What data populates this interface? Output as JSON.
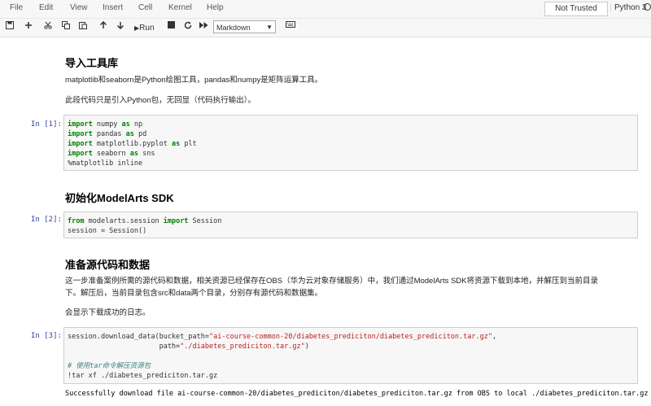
{
  "menu": [
    "File",
    "Edit",
    "View",
    "Insert",
    "Cell",
    "Kernel",
    "Help"
  ],
  "trusted_label": "Not Trusted",
  "kernel_name": "Python 3",
  "toolbar": {
    "run_label": "Run",
    "cell_type": "Markdown"
  },
  "sections": {
    "s1": {
      "heading": "导入工具库",
      "p1": "matplotlib和seaborn是Python绘图工具，pandas和numpy是矩阵运算工具。",
      "p2": "此段代码只是引入Python包，无回显（代码执行输出）。"
    },
    "cell1": {
      "prompt": "In [1]:",
      "lines": [
        [
          {
            "t": "import",
            "c": "kw"
          },
          {
            "t": " numpy "
          },
          {
            "t": "as",
            "c": "kw"
          },
          {
            "t": " np"
          }
        ],
        [
          {
            "t": "import",
            "c": "kw"
          },
          {
            "t": " pandas "
          },
          {
            "t": "as",
            "c": "kw"
          },
          {
            "t": " pd"
          }
        ],
        [
          {
            "t": "import",
            "c": "kw"
          },
          {
            "t": " matplotlib.pyplot "
          },
          {
            "t": "as",
            "c": "kw"
          },
          {
            "t": " plt"
          }
        ],
        [
          {
            "t": "import",
            "c": "kw"
          },
          {
            "t": " seaborn "
          },
          {
            "t": "as",
            "c": "kw"
          },
          {
            "t": " sns"
          }
        ],
        [
          {
            "t": "%matplotlib inline"
          }
        ]
      ]
    },
    "s2": {
      "heading": "初始化ModelArts SDK"
    },
    "cell2": {
      "prompt": "In [2]:",
      "lines": [
        [
          {
            "t": "from",
            "c": "kw"
          },
          {
            "t": " modelarts.session "
          },
          {
            "t": "import",
            "c": "kw"
          },
          {
            "t": " Session"
          }
        ],
        [
          {
            "t": "session = Session()"
          }
        ]
      ]
    },
    "s3": {
      "heading": "准备源代码和数据",
      "p1_line1": "这一步准备案例所需的源代码和数据，相关资源已经保存在OBS（华为云对象存储服务）中，我们通过ModelArts SDK将资源下载到本地，并解压到当前目录",
      "p1_line2": "下。解压后，当前目录包含src和data两个目录，分别存有源代码和数据集。",
      "p2": "会显示下载成功的日志。"
    },
    "cell3": {
      "prompt": "In [3]:",
      "lines": [
        [
          {
            "t": "session.download_data(bucket_path="
          },
          {
            "t": "\"ai-course-common-20/diabetes_prediciton/diabetes_prediciton.tar.gz\"",
            "c": "str"
          },
          {
            "t": ","
          }
        ],
        [
          {
            "t": "                      path="
          },
          {
            "t": "\"./diabetes_prediciton.tar.gz\"",
            "c": "str"
          },
          {
            "t": ")"
          }
        ],
        [
          {
            "t": ""
          }
        ],
        [
          {
            "t": "# 使用tar命令解压资源包",
            "c": "cm"
          }
        ],
        [
          {
            "t": "!tar xf ./diabetes_prediciton.tar.gz"
          }
        ]
      ],
      "output": "Successfully download file ai-course-common-20/diabetes_prediciton/diabetes_prediciton.tar.gz from OBS to local ./diabetes_prediciton.tar.gz"
    }
  }
}
